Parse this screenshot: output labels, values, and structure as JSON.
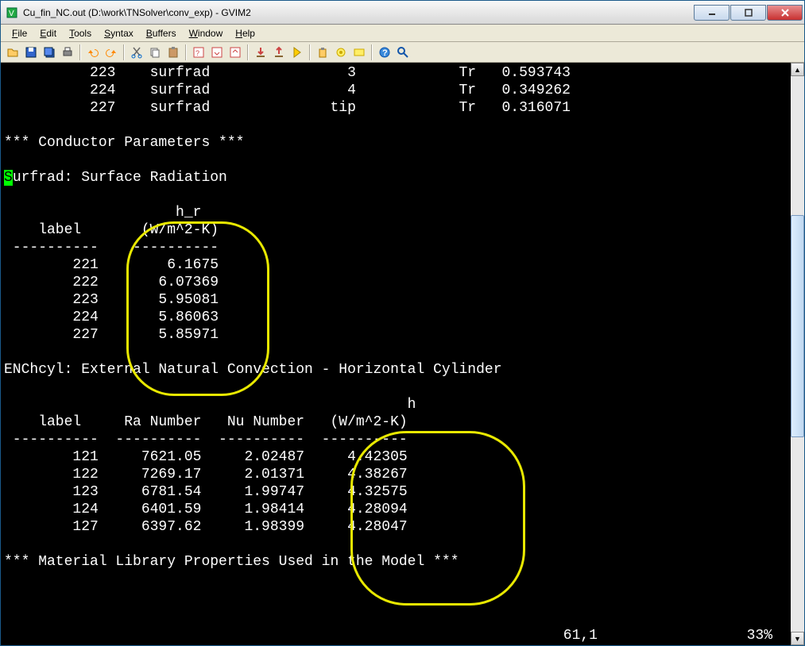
{
  "window": {
    "title": "Cu_fin_NC.out (D:\\work\\TNSolver\\conv_exp) - GVIM2",
    "min_label": "—",
    "max_label": "□",
    "close_label": "X"
  },
  "menu": {
    "file": "File",
    "edit": "Edit",
    "tools": "Tools",
    "syntax": "Syntax",
    "buffers": "Buffers",
    "window": "Window",
    "help": "Help"
  },
  "toolbar_icons": [
    "open-icon",
    "save-icon",
    "save-all-icon",
    "print-icon",
    "sep",
    "undo-icon",
    "redo-icon",
    "sep",
    "cut-icon",
    "copy-icon",
    "paste-icon",
    "sep",
    "find-icon",
    "find-next-icon",
    "find-prev-icon",
    "sep",
    "load-session-icon",
    "save-session-icon",
    "run-script-icon",
    "sep",
    "make-icon",
    "shell-icon",
    "tags-icon",
    "sep",
    "help-icon",
    "find-help-icon"
  ],
  "text": {
    "top_rows": [
      {
        "id": "223",
        "type": "surfrad",
        "n": "3",
        "tr": "Tr",
        "val": "0.593743"
      },
      {
        "id": "224",
        "type": "surfrad",
        "n": "4",
        "tr": "Tr",
        "val": "0.349262"
      },
      {
        "id": "227",
        "type": "surfrad",
        "n": "tip",
        "tr": "Tr",
        "val": "0.316071"
      }
    ],
    "section1": "*** Conductor Parameters ***",
    "surfrad_title_first": "S",
    "surfrad_title_rest": "urfrad: Surface Radiation",
    "surfrad_header_l1": "                    h_r",
    "surfrad_header_l2": "    label       (W/m^2-K)",
    "surfrad_divider": " ----------    ----------",
    "surfrad_rows": [
      {
        "label": "221",
        "hr": "6.1675"
      },
      {
        "label": "222",
        "hr": "6.07369"
      },
      {
        "label": "223",
        "hr": "5.95081"
      },
      {
        "label": "224",
        "hr": "5.86063"
      },
      {
        "label": "227",
        "hr": "5.85971"
      }
    ],
    "enc_title": "ENChcyl: External Natural Convection - Horizontal Cylinder",
    "enc_header_l1": "                                               h",
    "enc_header_l2": "    label     Ra Number   Nu Number   (W/m^2-K)",
    "enc_divider": " ----------  ----------  ----------  ----------",
    "enc_rows": [
      {
        "label": "121",
        "ra": "7621.05",
        "nu": "2.02487",
        "h": "4.42305"
      },
      {
        "label": "122",
        "ra": "7269.17",
        "nu": "2.01371",
        "h": "4.38267"
      },
      {
        "label": "123",
        "ra": "6781.54",
        "nu": "1.99747",
        "h": "4.32575"
      },
      {
        "label": "124",
        "ra": "6401.59",
        "nu": "1.98414",
        "h": "4.28094"
      },
      {
        "label": "127",
        "ra": "6397.62",
        "nu": "1.98399",
        "h": "4.28047"
      }
    ],
    "section2": "*** Material Library Properties Used in the Model ***"
  },
  "status": {
    "position": "61,1",
    "percent": "33%"
  }
}
